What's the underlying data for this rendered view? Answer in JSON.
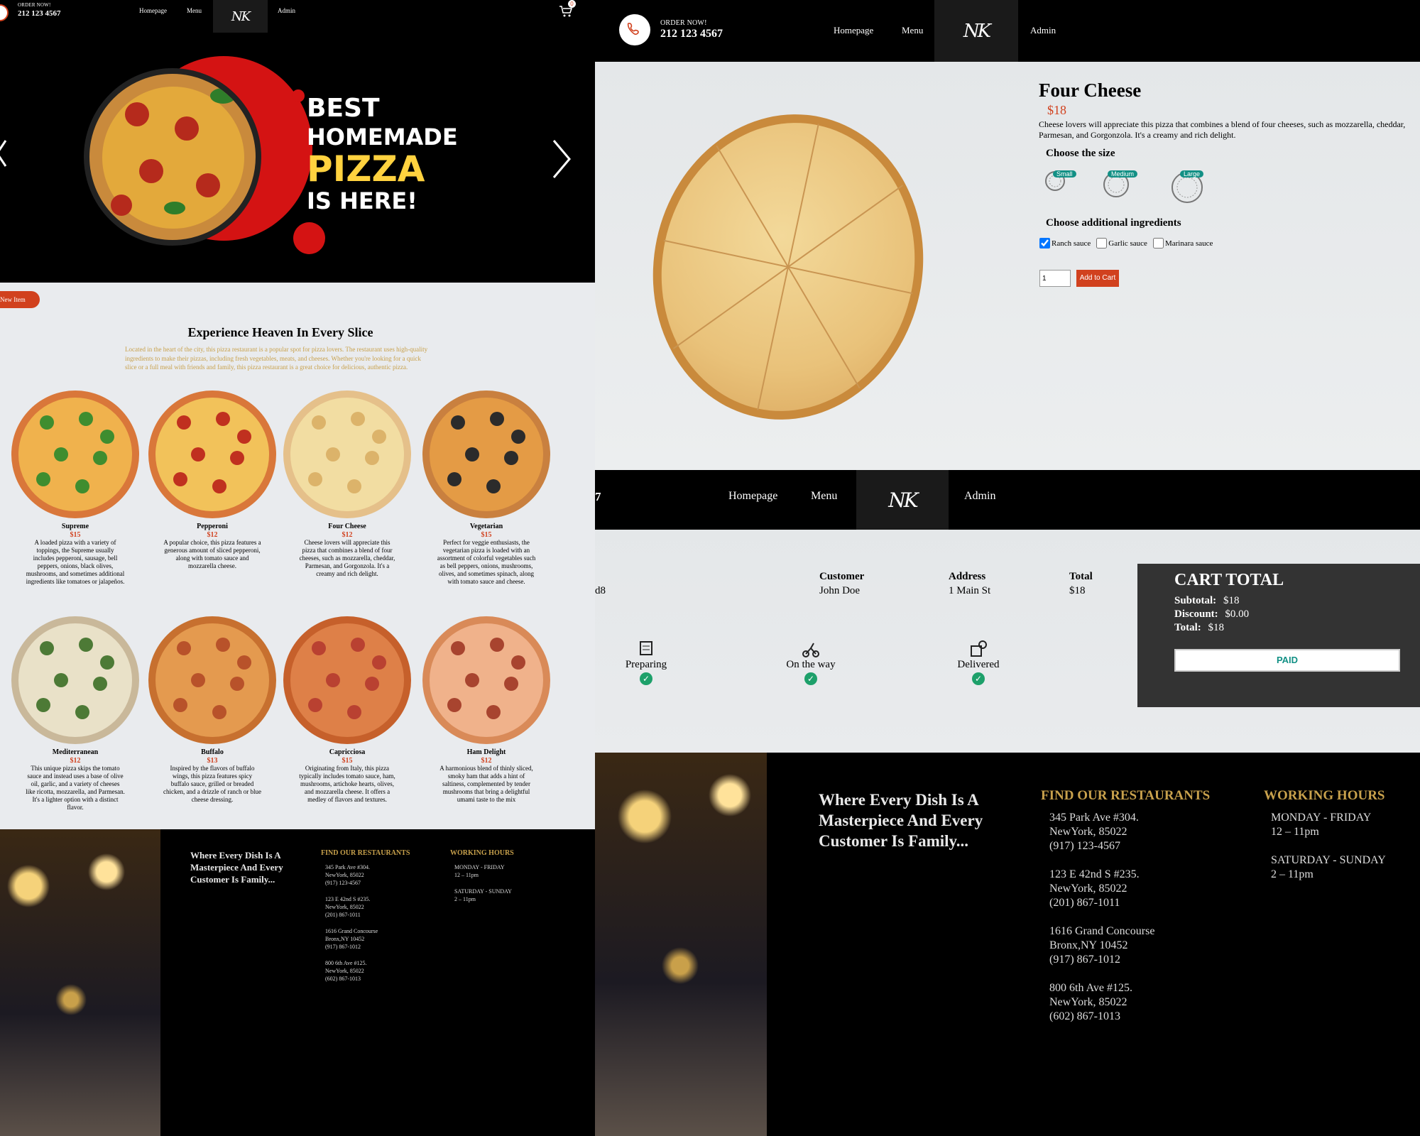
{
  "nav": {
    "order_label": "ORDER NOW!",
    "phone": "212 123 4567",
    "links": [
      "Homepage",
      "Menu",
      "Admin"
    ],
    "logo_text": "Nina's Kitchen",
    "cart_count": "0"
  },
  "hero": {
    "line1": "BEST",
    "line2": "HOMEMADE",
    "line3": "PIZZA",
    "line4": "IS HERE!",
    "accent": "#d41313",
    "pizza_word_color": "#ffd23f"
  },
  "menu_page": {
    "new_item_button": "New Item",
    "title": "Experience Heaven In Every Slice",
    "intro": "Located in the heart of the city, this pizza restaurant is a popular spot for pizza lovers. The restaurant uses high-quality ingredients to make their pizzas, including fresh vegetables, meats, and cheeses. Whether you're looking for a quick slice or a full meal with friends and family, this pizza restaurant is a great choice for delicious, authentic pizza.",
    "items": [
      {
        "name": "Supreme",
        "price": "$15",
        "desc": "A loaded pizza with a variety of toppings, the Supreme usually includes pepperoni, sausage, bell peppers, onions, black olives, mushrooms, and sometimes additional ingredients like tomatoes or jalapeños."
      },
      {
        "name": "Pepperoni",
        "price": "$12",
        "desc": "A popular choice, this pizza features a generous amount of sliced pepperoni, along with tomato sauce and mozzarella cheese."
      },
      {
        "name": "Four Cheese",
        "price": "$12",
        "desc": "Cheese lovers will appreciate this pizza that combines a blend of four cheeses, such as mozzarella, cheddar, Parmesan, and Gorgonzola. It's a creamy and rich delight."
      },
      {
        "name": "Vegetarian",
        "price": "$15",
        "desc": "Perfect for veggie enthusiasts, the vegetarian pizza is loaded with an assortment of colorful vegetables such as bell peppers, onions, mushrooms, olives, and sometimes spinach, along with tomato sauce and cheese."
      },
      {
        "name": "Mediterranean",
        "price": "$12",
        "desc": "This unique pizza skips the tomato sauce and instead uses a base of olive oil, garlic, and a variety of cheeses like ricotta, mozzarella, and Parmesan. It's a lighter option with a distinct flavor."
      },
      {
        "name": "Buffalo",
        "price": "$13",
        "desc": "Inspired by the flavors of buffalo wings, this pizza features spicy buffalo sauce, grilled or breaded chicken, and a drizzle of ranch or blue cheese dressing."
      },
      {
        "name": "Capricciosa",
        "price": "$15",
        "desc": "Originating from Italy, this pizza typically includes tomato sauce, ham, mushrooms, artichoke hearts, olives, and mozzarella cheese. It offers a medley of flavors and textures."
      },
      {
        "name": "Ham Delight",
        "price": "$12",
        "desc": "A harmonious blend of thinly sliced, smoky ham that adds a hint of saltiness, complemented by tender mushrooms that bring a delightful umami taste to the mix"
      }
    ]
  },
  "product": {
    "name": "Four Cheese",
    "price": "$18",
    "desc": "Cheese lovers will appreciate this pizza that combines a blend of four cheeses, such as mozzarella, cheddar, Parmesan, and Gorgonzola. It's a creamy and rich delight.",
    "size_heading": "Choose the size",
    "sizes": [
      "Small",
      "Medium",
      "Large"
    ],
    "extras_heading": "Choose additional ingredients",
    "extras": [
      {
        "label": "Ranch sauce",
        "checked": true
      },
      {
        "label": "Garlic sauce",
        "checked": false
      },
      {
        "label": "Marinara sauce",
        "checked": false
      }
    ],
    "quantity": "1",
    "add_button": "Add to Cart"
  },
  "order": {
    "id_fragment_left": "7",
    "id_fragment": "d8",
    "headers": [
      "Customer",
      "Address",
      "Total"
    ],
    "values": [
      "John Doe",
      "1 Main St",
      "$18"
    ],
    "statuses": [
      "Preparing",
      "On the way",
      "Delivered"
    ],
    "cart_total_title": "CART TOTAL",
    "subtotal_label": "Subtotal:",
    "subtotal": "$18",
    "discount_label": "Discount:",
    "discount": "$0.00",
    "total_label": "Total:",
    "total": "$18",
    "paid_button": "PAID"
  },
  "footer": {
    "slogan": "Where Every Dish Is A Masterpiece And Every Customer Is Family...",
    "restaurants_title": "FIND OUR RESTAURANTS",
    "restaurants": [
      {
        "line1": "345 Park Ave #304.",
        "line2": "NewYork, 85022",
        "line3": "(917) 123-4567"
      },
      {
        "line1": "123 E 42nd S #235.",
        "line2": "NewYork, 85022",
        "line3": "(201) 867-1011"
      },
      {
        "line1": "1616 Grand Concourse",
        "line2": "Bronx,NY 10452",
        "line3": "(917) 867-1012"
      },
      {
        "line1": "800 6th Ave #125.",
        "line2": "NewYork, 85022",
        "line3": "(602) 867-1013"
      }
    ],
    "hours_title": "WORKING HOURS",
    "hours": [
      {
        "days": "MONDAY - FRIDAY",
        "time": "12 – 11pm"
      },
      {
        "days": "SATURDAY - SUNDAY",
        "time": "2 – 11pm"
      }
    ]
  }
}
